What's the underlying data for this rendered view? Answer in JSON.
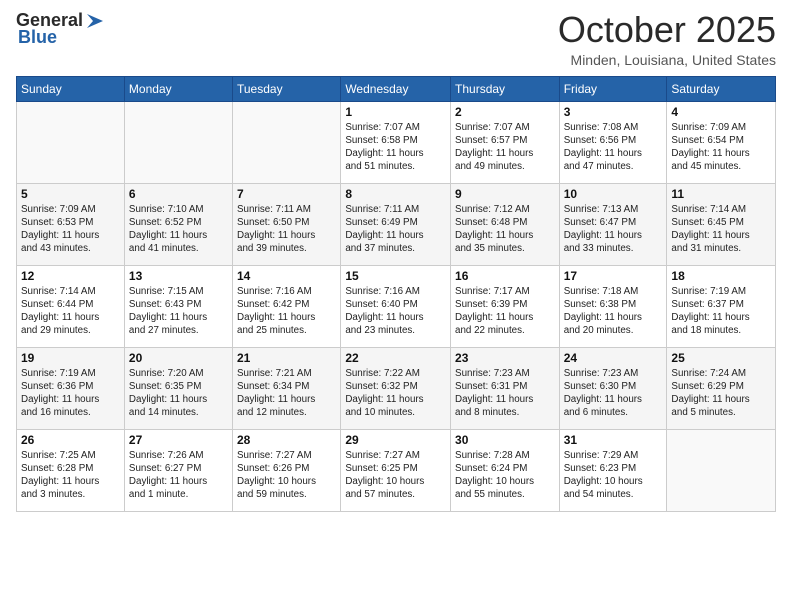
{
  "header": {
    "logo_general": "General",
    "logo_blue": "Blue",
    "month_title": "October 2025",
    "location": "Minden, Louisiana, United States"
  },
  "days_of_week": [
    "Sunday",
    "Monday",
    "Tuesday",
    "Wednesday",
    "Thursday",
    "Friday",
    "Saturday"
  ],
  "weeks": [
    [
      {
        "day": "",
        "info": ""
      },
      {
        "day": "",
        "info": ""
      },
      {
        "day": "",
        "info": ""
      },
      {
        "day": "1",
        "info": "Sunrise: 7:07 AM\nSunset: 6:58 PM\nDaylight: 11 hours\nand 51 minutes."
      },
      {
        "day": "2",
        "info": "Sunrise: 7:07 AM\nSunset: 6:57 PM\nDaylight: 11 hours\nand 49 minutes."
      },
      {
        "day": "3",
        "info": "Sunrise: 7:08 AM\nSunset: 6:56 PM\nDaylight: 11 hours\nand 47 minutes."
      },
      {
        "day": "4",
        "info": "Sunrise: 7:09 AM\nSunset: 6:54 PM\nDaylight: 11 hours\nand 45 minutes."
      }
    ],
    [
      {
        "day": "5",
        "info": "Sunrise: 7:09 AM\nSunset: 6:53 PM\nDaylight: 11 hours\nand 43 minutes."
      },
      {
        "day": "6",
        "info": "Sunrise: 7:10 AM\nSunset: 6:52 PM\nDaylight: 11 hours\nand 41 minutes."
      },
      {
        "day": "7",
        "info": "Sunrise: 7:11 AM\nSunset: 6:50 PM\nDaylight: 11 hours\nand 39 minutes."
      },
      {
        "day": "8",
        "info": "Sunrise: 7:11 AM\nSunset: 6:49 PM\nDaylight: 11 hours\nand 37 minutes."
      },
      {
        "day": "9",
        "info": "Sunrise: 7:12 AM\nSunset: 6:48 PM\nDaylight: 11 hours\nand 35 minutes."
      },
      {
        "day": "10",
        "info": "Sunrise: 7:13 AM\nSunset: 6:47 PM\nDaylight: 11 hours\nand 33 minutes."
      },
      {
        "day": "11",
        "info": "Sunrise: 7:14 AM\nSunset: 6:45 PM\nDaylight: 11 hours\nand 31 minutes."
      }
    ],
    [
      {
        "day": "12",
        "info": "Sunrise: 7:14 AM\nSunset: 6:44 PM\nDaylight: 11 hours\nand 29 minutes."
      },
      {
        "day": "13",
        "info": "Sunrise: 7:15 AM\nSunset: 6:43 PM\nDaylight: 11 hours\nand 27 minutes."
      },
      {
        "day": "14",
        "info": "Sunrise: 7:16 AM\nSunset: 6:42 PM\nDaylight: 11 hours\nand 25 minutes."
      },
      {
        "day": "15",
        "info": "Sunrise: 7:16 AM\nSunset: 6:40 PM\nDaylight: 11 hours\nand 23 minutes."
      },
      {
        "day": "16",
        "info": "Sunrise: 7:17 AM\nSunset: 6:39 PM\nDaylight: 11 hours\nand 22 minutes."
      },
      {
        "day": "17",
        "info": "Sunrise: 7:18 AM\nSunset: 6:38 PM\nDaylight: 11 hours\nand 20 minutes."
      },
      {
        "day": "18",
        "info": "Sunrise: 7:19 AM\nSunset: 6:37 PM\nDaylight: 11 hours\nand 18 minutes."
      }
    ],
    [
      {
        "day": "19",
        "info": "Sunrise: 7:19 AM\nSunset: 6:36 PM\nDaylight: 11 hours\nand 16 minutes."
      },
      {
        "day": "20",
        "info": "Sunrise: 7:20 AM\nSunset: 6:35 PM\nDaylight: 11 hours\nand 14 minutes."
      },
      {
        "day": "21",
        "info": "Sunrise: 7:21 AM\nSunset: 6:34 PM\nDaylight: 11 hours\nand 12 minutes."
      },
      {
        "day": "22",
        "info": "Sunrise: 7:22 AM\nSunset: 6:32 PM\nDaylight: 11 hours\nand 10 minutes."
      },
      {
        "day": "23",
        "info": "Sunrise: 7:23 AM\nSunset: 6:31 PM\nDaylight: 11 hours\nand 8 minutes."
      },
      {
        "day": "24",
        "info": "Sunrise: 7:23 AM\nSunset: 6:30 PM\nDaylight: 11 hours\nand 6 minutes."
      },
      {
        "day": "25",
        "info": "Sunrise: 7:24 AM\nSunset: 6:29 PM\nDaylight: 11 hours\nand 5 minutes."
      }
    ],
    [
      {
        "day": "26",
        "info": "Sunrise: 7:25 AM\nSunset: 6:28 PM\nDaylight: 11 hours\nand 3 minutes."
      },
      {
        "day": "27",
        "info": "Sunrise: 7:26 AM\nSunset: 6:27 PM\nDaylight: 11 hours\nand 1 minute."
      },
      {
        "day": "28",
        "info": "Sunrise: 7:27 AM\nSunset: 6:26 PM\nDaylight: 10 hours\nand 59 minutes."
      },
      {
        "day": "29",
        "info": "Sunrise: 7:27 AM\nSunset: 6:25 PM\nDaylight: 10 hours\nand 57 minutes."
      },
      {
        "day": "30",
        "info": "Sunrise: 7:28 AM\nSunset: 6:24 PM\nDaylight: 10 hours\nand 55 minutes."
      },
      {
        "day": "31",
        "info": "Sunrise: 7:29 AM\nSunset: 6:23 PM\nDaylight: 10 hours\nand 54 minutes."
      },
      {
        "day": "",
        "info": ""
      }
    ]
  ]
}
